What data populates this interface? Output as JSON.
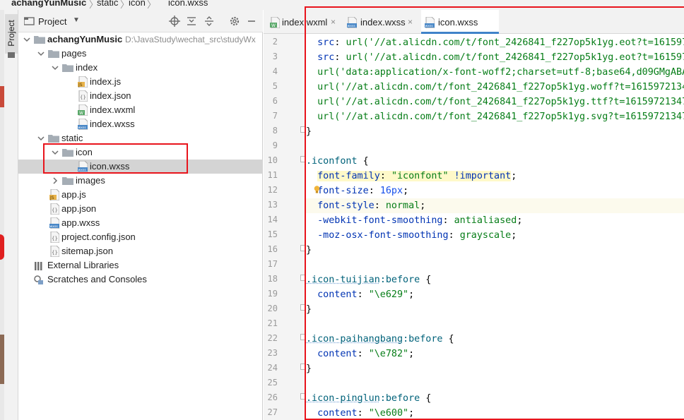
{
  "breadcrumb": {
    "project": "achangYunMusic",
    "folder1": "static",
    "folder2": "icon",
    "file": "icon.wxss",
    "file_badge": "wxss"
  },
  "tool_strip": {
    "project_tab": "Project"
  },
  "project_panel": {
    "title": "Project",
    "tree": [
      {
        "label": "achangYunMusic",
        "path": "D:\\JavaStudy\\wechat_src\\studyWx",
        "type": "root-folder"
      },
      {
        "label": "pages",
        "type": "folder"
      },
      {
        "label": "index",
        "type": "folder"
      },
      {
        "label": "index.js",
        "type": "file",
        "badge": "JS"
      },
      {
        "label": "index.json",
        "type": "file",
        "badge": "{}"
      },
      {
        "label": "index.wxml",
        "type": "file",
        "badge": "W"
      },
      {
        "label": "index.wxss",
        "type": "file",
        "badge": "wxss"
      },
      {
        "label": "static",
        "type": "folder"
      },
      {
        "label": "icon",
        "type": "folder"
      },
      {
        "label": "icon.wxss",
        "type": "file",
        "badge": "wxss"
      },
      {
        "label": "images",
        "type": "folder"
      },
      {
        "label": "app.js",
        "type": "file",
        "badge": "JS"
      },
      {
        "label": "app.json",
        "type": "file",
        "badge": "{}"
      },
      {
        "label": "app.wxss",
        "type": "file",
        "badge": "wxss"
      },
      {
        "label": "project.config.json",
        "type": "file",
        "badge": "{}"
      },
      {
        "label": "sitemap.json",
        "type": "file",
        "badge": "{}"
      },
      {
        "label": "External Libraries",
        "type": "library"
      },
      {
        "label": "Scratches and Consoles",
        "type": "scratch"
      }
    ]
  },
  "editor": {
    "tabs": [
      {
        "label": "index.wxml",
        "badge": "W",
        "close": "×"
      },
      {
        "label": "index.wxss",
        "badge": "wxss",
        "close": "×"
      },
      {
        "label": "icon.wxss",
        "badge": "wxss",
        "close": ""
      }
    ],
    "active_tab": 2,
    "line_numbers": [
      "2",
      "3",
      "4",
      "5",
      "6",
      "7",
      "8",
      "9",
      "10",
      "11",
      "12",
      "13",
      "14",
      "15",
      "16",
      "17",
      "18",
      "19",
      "20",
      "21",
      "22",
      "23",
      "24",
      "25",
      "26",
      "27"
    ],
    "code": {
      "l2_prop": "src",
      "l2_url": "url('//at.alicdn.com/t/font_2426841_f227op5k1yg.eot?t=1615972134",
      "l3_prop": "src",
      "l3_url": "url('//at.alicdn.com/t/font_2426841_f227op5k1yg.eot?t=1615972134",
      "l4_url": "url('data:application/x-font-woff2;charset=utf-8;base64,d09GMgABAAA",
      "l5_url": "url('//at.alicdn.com/t/font_2426841_f227op5k1yg.woff?t=16159721347",
      "l6_url": "url('//at.alicdn.com/t/font_2426841_f227op5k1yg.ttf?t=161597213475",
      "l7_url": "url('//at.alicdn.com/t/font_2426841_f227op5k1yg.svg?t=161597213475",
      "l8": "}",
      "l10_sel": ".iconfont",
      "l11_prop": "font-family",
      "l11_val": "\"iconfont\"",
      "l11_imp": "!important",
      "l12_prop": "font-size",
      "l12_val": "16px",
      "l13_prop": "font-style",
      "l13_val": "normal",
      "l14_prop": "-webkit-font-smoothing",
      "l14_val": "antialiased",
      "l15_prop": "-moz-osx-font-smoothing",
      "l15_val": "grayscale",
      "l16": "}",
      "l18_sel": ".icon-tuijian",
      "l18_pseudo": ":before",
      "l19_prop": "content",
      "l19_val": "\"\\e629\"",
      "l20": "}",
      "l22_sel": ".icon-paihangbang",
      "l22_pseudo": ":before",
      "l23_prop": "content",
      "l23_val": "\"\\e782\"",
      "l24": "}",
      "l26_sel": ".icon-pinglun",
      "l26_pseudo": ":before",
      "l27_prop": "content",
      "l27_val": "\"\\e600\""
    }
  },
  "colors": {
    "annotation": "#e8141c",
    "active_tab_underline": "#4083c9",
    "selected_row": "#d4d4d4",
    "property": "#0033b3",
    "string": "#067d17",
    "selector": "#00627a",
    "number": "#1750eb"
  },
  "icons": [
    "folder-icon",
    "js-file-icon",
    "json-file-icon",
    "wxml-file-icon",
    "wxss-file-icon",
    "locate-icon",
    "expand-all-icon",
    "collapse-all-icon",
    "gear-icon",
    "minimize-icon",
    "lightbulb-icon",
    "library-icon",
    "scratch-icon"
  ]
}
